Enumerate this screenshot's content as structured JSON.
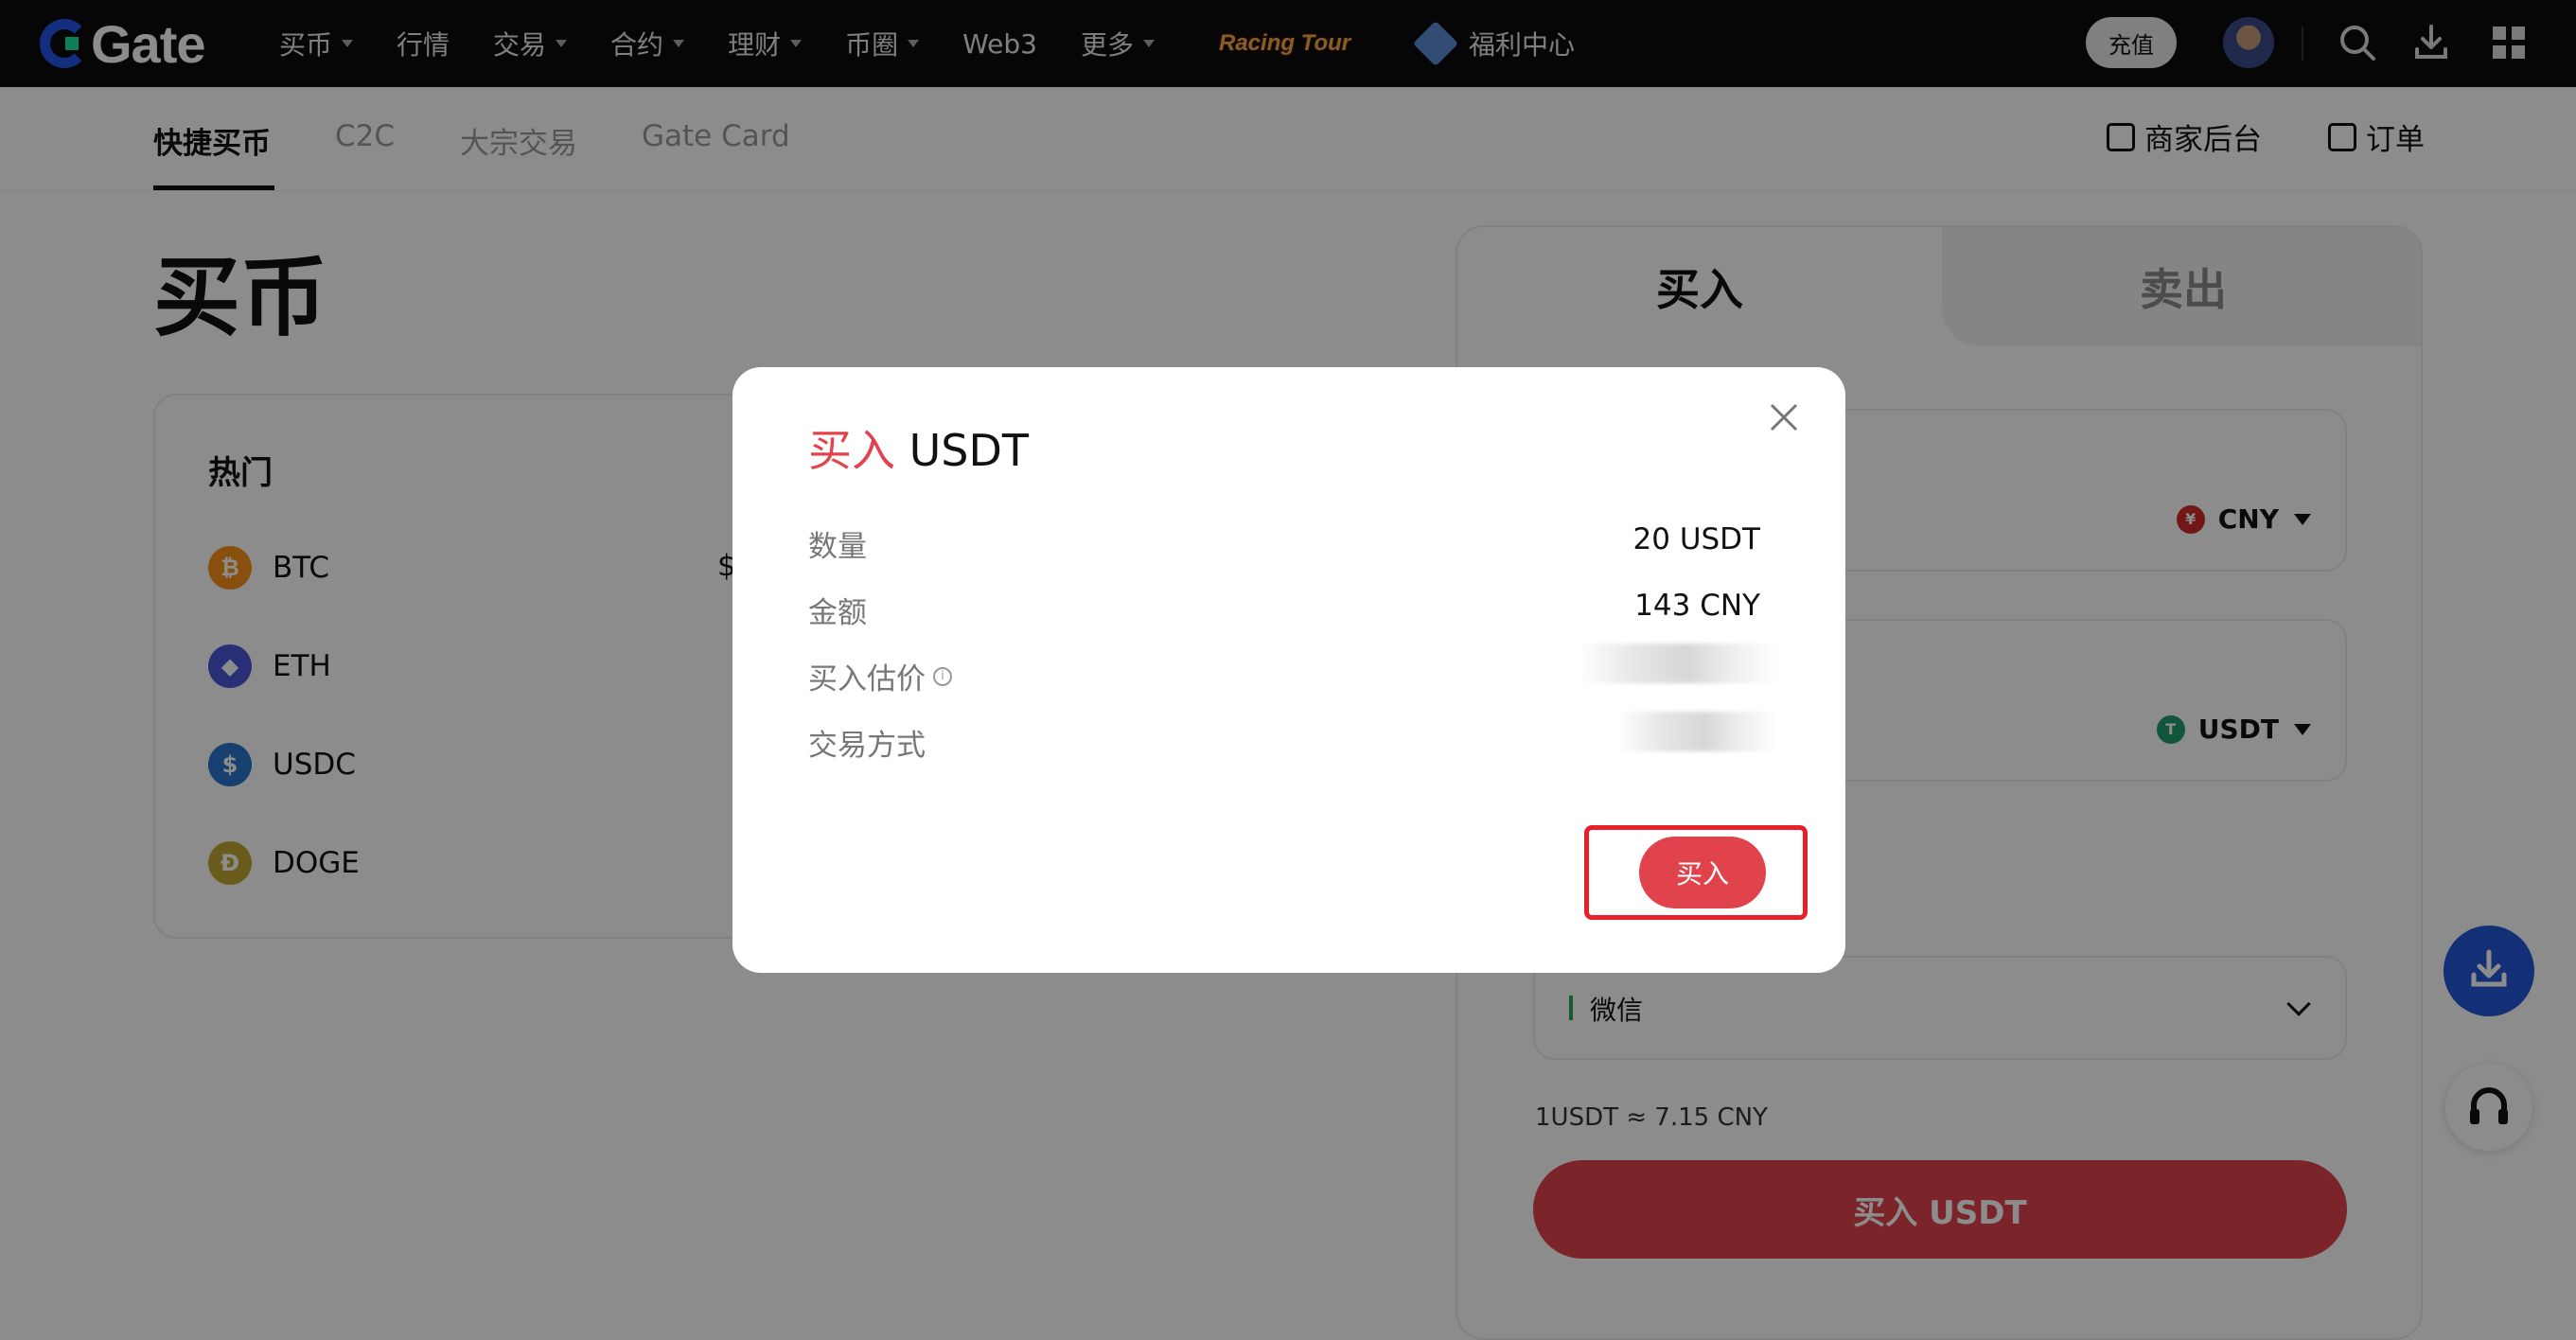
{
  "nav": {
    "logo": "Gate",
    "items": [
      {
        "label": "买币",
        "caret": true
      },
      {
        "label": "行情",
        "caret": false
      },
      {
        "label": "交易",
        "caret": true
      },
      {
        "label": "合约",
        "caret": true
      },
      {
        "label": "理财",
        "caret": true
      },
      {
        "label": "币圈",
        "caret": true
      },
      {
        "label": "Web3",
        "caret": false
      },
      {
        "label": "更多",
        "caret": true
      }
    ],
    "racing_label": "Racing Tour",
    "welfare_label": "福利中心",
    "recharge_label": "充值",
    "icons": [
      "search-icon",
      "download-icon",
      "grid-icon"
    ]
  },
  "subnav": {
    "tabs": [
      "快捷买币",
      "C2C",
      "大宗交易",
      "Gate Card"
    ],
    "active_tab": "快捷买币",
    "merchant_label": "商家后台",
    "orders_label": "订单"
  },
  "page": {
    "title": "买币",
    "hot_title": "热门",
    "price_prefix": "$",
    "coins": [
      {
        "symbol": "BTC",
        "color": "#f7931a",
        "glyph": "₿"
      },
      {
        "symbol": "ETH",
        "color": "#4a56d6",
        "glyph": "◆"
      },
      {
        "symbol": "USDC",
        "color": "#2775ca",
        "glyph": "$"
      },
      {
        "symbol": "DOGE",
        "color": "#c2a633",
        "glyph": "Ð"
      }
    ]
  },
  "trade": {
    "tab_buy": "买入",
    "tab_sell": "卖出",
    "fiat_currency": "CNY",
    "crypto_currency": "USDT",
    "pay_method": "微信",
    "rate_text": "1USDT ≈ 7.15 CNY",
    "buy_button": "买入 USDT"
  },
  "modal": {
    "title_action": "买入",
    "title_asset": "USDT",
    "rows": [
      {
        "label": "数量",
        "value": "20 USDT"
      },
      {
        "label": "金额",
        "value": "143 CNY"
      },
      {
        "label": "买入估价",
        "value": ""
      },
      {
        "label": "交易方式",
        "value": ""
      }
    ],
    "confirm_label": "买入"
  },
  "colors": {
    "accent": "#e1434d",
    "brand_blue": "#2354e6",
    "nav_bg": "#0b0b0b",
    "highlight": "#e8202a"
  }
}
